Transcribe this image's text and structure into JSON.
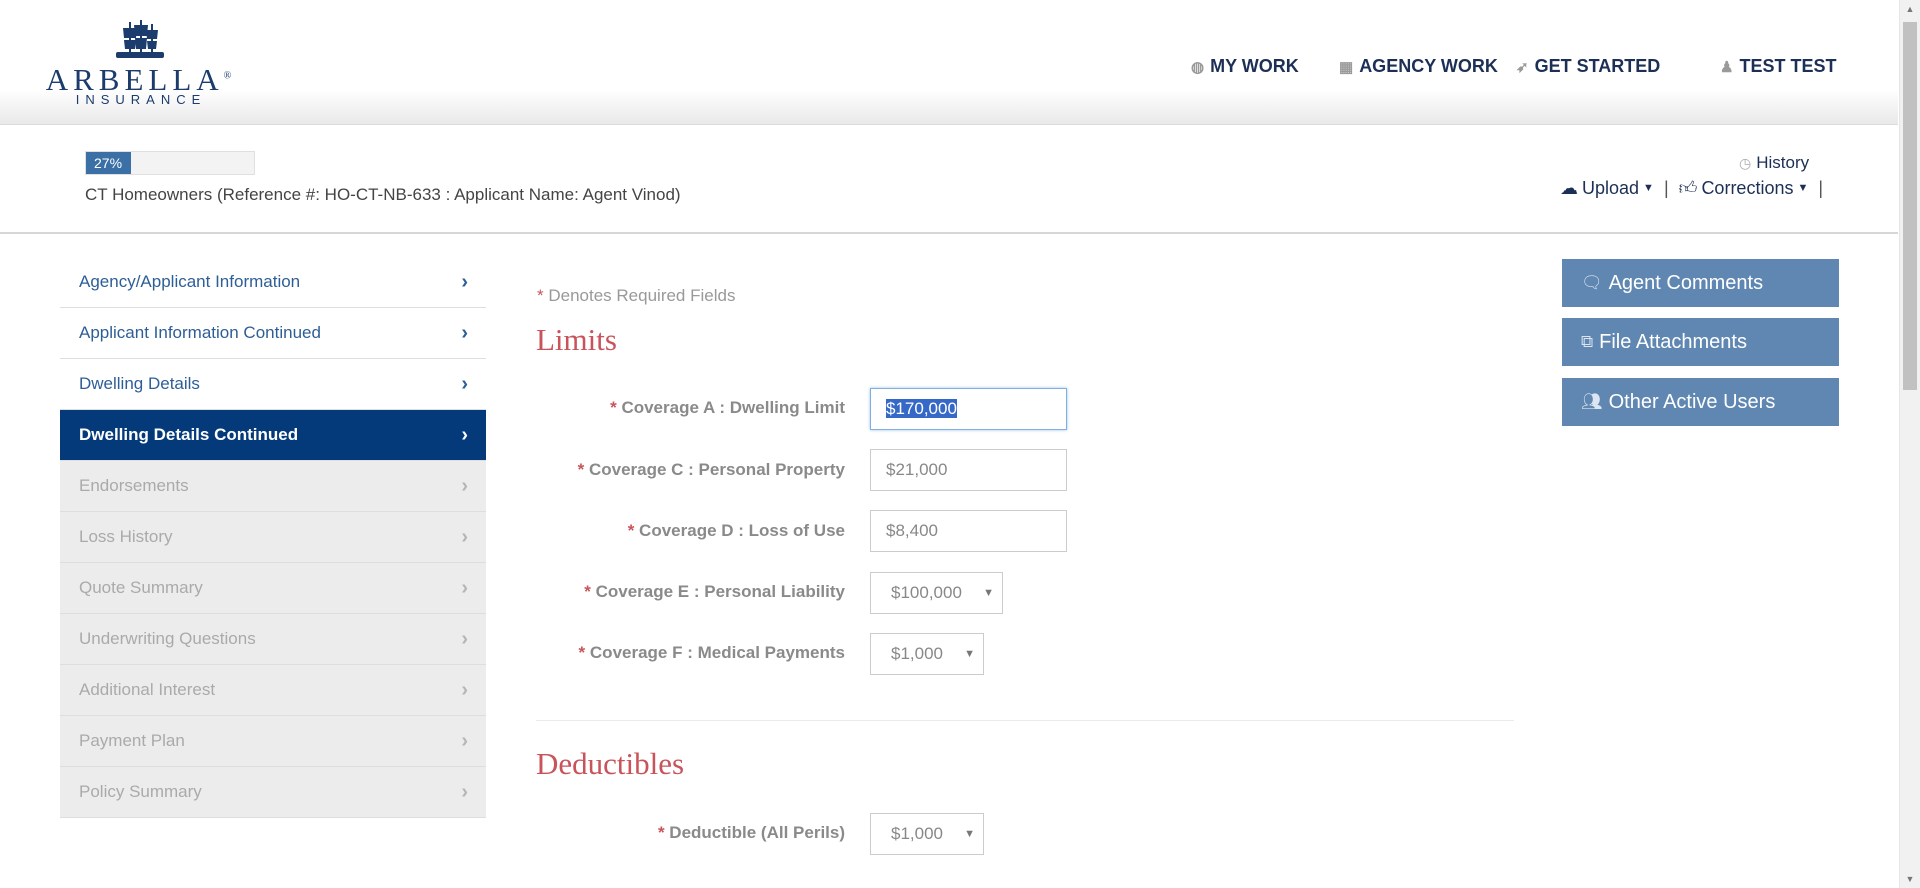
{
  "brand": {
    "wordmark": "ARBELLA",
    "sub": "INSURANCE",
    "registered": "®",
    "colors": {
      "navy": "#1c3c6e",
      "accent_red": "#c9535a",
      "active_nav": "#053a7a",
      "button_blue": "#5f87b2"
    }
  },
  "topnav": [
    {
      "icon": "dashboard-icon",
      "glyph": "◍",
      "label": "MY WORK"
    },
    {
      "icon": "grid-icon",
      "glyph": "▦",
      "label": "AGENCY WORK"
    },
    {
      "icon": "rocket-icon",
      "glyph": "➶",
      "label": "GET STARTED"
    },
    {
      "icon": "user-icon",
      "glyph": "♟",
      "label": "TEST TEST"
    }
  ],
  "subheader": {
    "progress_value": 0.27,
    "progress_label": "27%",
    "reference": "CT Homeowners (Reference #: HO-CT-NB-633 : Applicant Name: Agent Vinod)",
    "history": "History",
    "upload": "Upload",
    "corrections": "Corrections",
    "separator": "|"
  },
  "sidebar": {
    "items": [
      {
        "label": "Agency/Applicant Information",
        "state": "enabled"
      },
      {
        "label": "Applicant Information Continued",
        "state": "enabled"
      },
      {
        "label": "Dwelling Details",
        "state": "enabled"
      },
      {
        "label": "Dwelling Details Continued",
        "state": "active"
      },
      {
        "label": "Endorsements",
        "state": "disabled"
      },
      {
        "label": "Loss History",
        "state": "disabled"
      },
      {
        "label": "Quote Summary",
        "state": "disabled"
      },
      {
        "label": "Underwriting Questions",
        "state": "disabled"
      },
      {
        "label": "Additional Interest",
        "state": "disabled"
      },
      {
        "label": "Payment Plan",
        "state": "disabled"
      },
      {
        "label": "Policy Summary",
        "state": "disabled"
      }
    ]
  },
  "form": {
    "required_star": "*",
    "required_note": "Denotes Required Fields",
    "limits_title": "Limits",
    "coverage_a": {
      "label": "Coverage A : Dwelling Limit",
      "value": "$170,000"
    },
    "coverage_c": {
      "label": "Coverage C : Personal Property",
      "value": "$21,000"
    },
    "coverage_d": {
      "label": "Coverage D : Loss of Use",
      "value": "$8,400"
    },
    "coverage_e": {
      "label": "Coverage E : Personal Liability",
      "value": "$100,000"
    },
    "coverage_f": {
      "label": "Coverage F : Medical Payments",
      "value": "$1,000"
    },
    "deductibles_title": "Deductibles",
    "deductible": {
      "label": "Deductible (All Perils)",
      "value": "$1,000"
    }
  },
  "right_panel": {
    "agent_comments": "Agent Comments",
    "file_attachments": "File Attachments",
    "other_active_users": "Other Active Users"
  }
}
